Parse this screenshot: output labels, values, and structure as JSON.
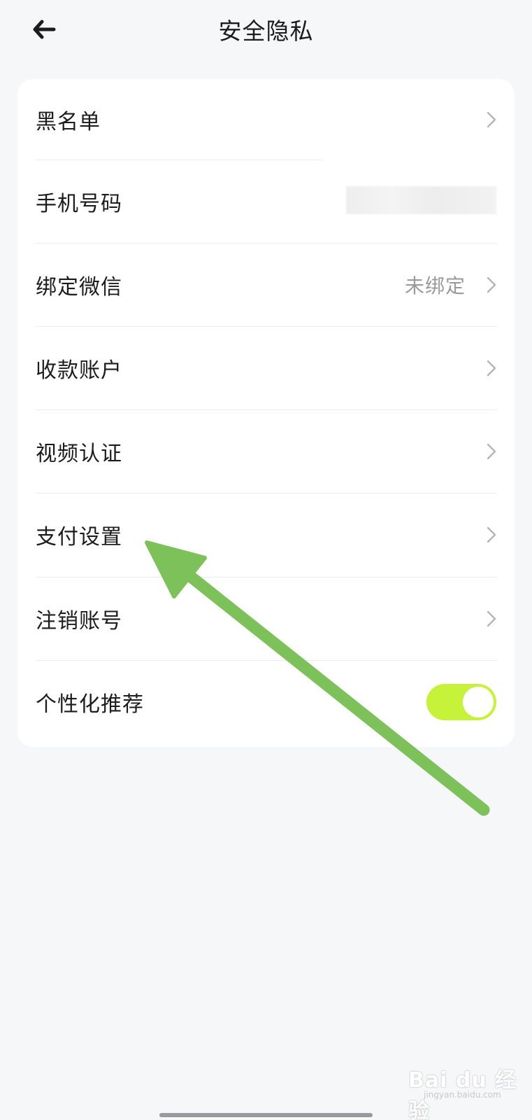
{
  "header": {
    "title": "安全隐私"
  },
  "items": [
    {
      "label": "黑名单",
      "value": ""
    },
    {
      "label": "手机号码",
      "value": ""
    },
    {
      "label": "绑定微信",
      "value": "未绑定"
    },
    {
      "label": "收款账户",
      "value": ""
    },
    {
      "label": "视频认证",
      "value": ""
    },
    {
      "label": "支付设置",
      "value": ""
    },
    {
      "label": "注销账号",
      "value": ""
    }
  ],
  "toggle_item": {
    "label": "个性化推荐",
    "on": true
  },
  "colors": {
    "background": "#f6f7f9",
    "card": "#ffffff",
    "toggle_on": "#c7f23a",
    "annotation_arrow": "#7dc15a",
    "secondary_text": "#9a9a9e"
  },
  "icons": {
    "back": "arrow-left-icon",
    "chevron": "chevron-right-icon"
  },
  "watermark": {
    "brand": "Bai du 经验",
    "url": "jingyan.baidu.com"
  }
}
